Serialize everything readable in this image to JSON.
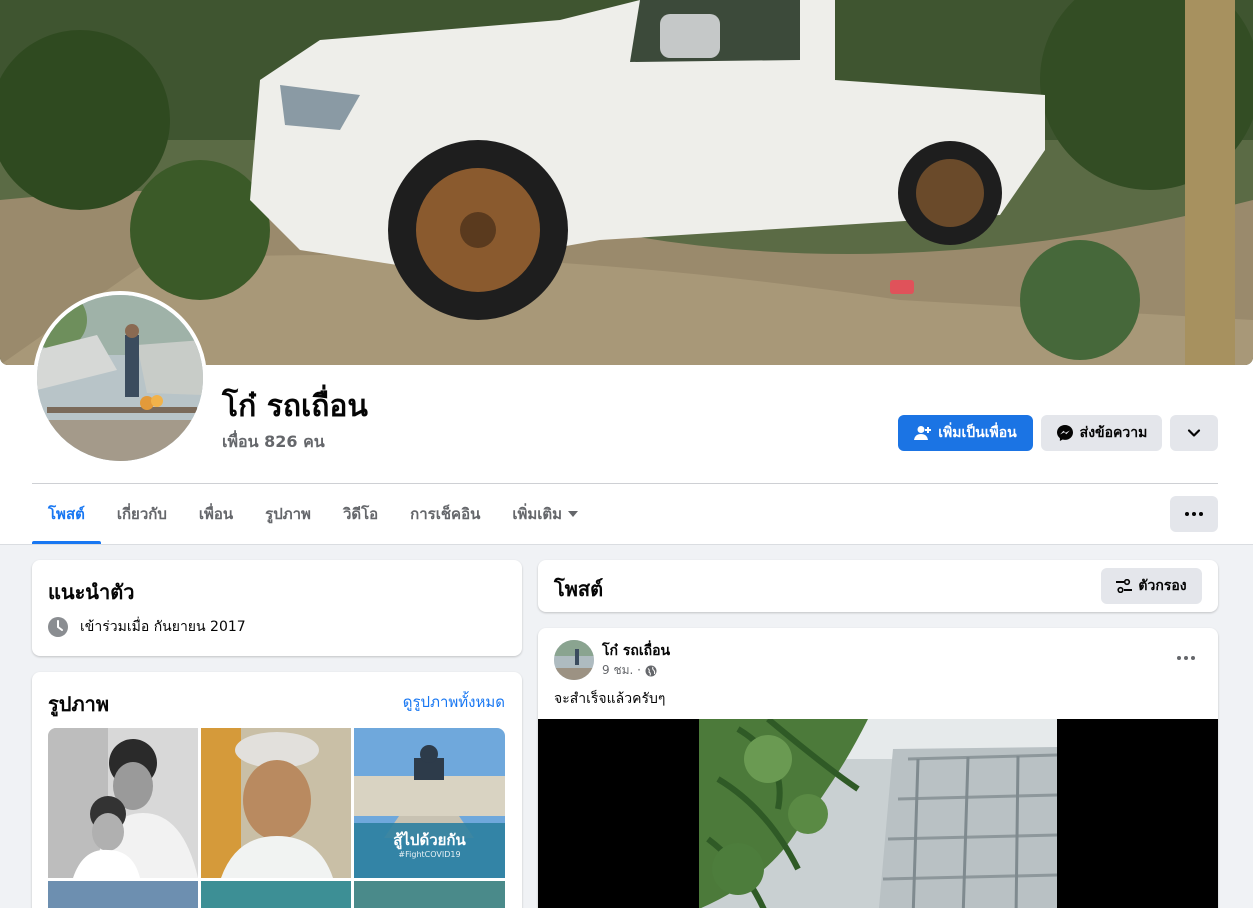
{
  "profile": {
    "name": "โก๋ รถเถื่อน",
    "friends_text": "เพื่อน 826 คน"
  },
  "actions": {
    "add_friend": "เพิ่มเป็นเพื่อน",
    "message": "ส่งข้อความ"
  },
  "tabs": [
    {
      "label": "โพสต์",
      "active": true
    },
    {
      "label": "เกี่ยวกับ"
    },
    {
      "label": "เพื่อน"
    },
    {
      "label": "รูปภาพ"
    },
    {
      "label": "วิดีโอ"
    },
    {
      "label": "การเช็คอิน"
    },
    {
      "label": "เพิ่มเติม"
    }
  ],
  "intro": {
    "title": "แนะนำตัว",
    "joined": "เข้าร่วมเมื่อ กันยายน 2017"
  },
  "photos": {
    "title": "รูปภาพ",
    "see_all": "ดูรูปภาพทั้งหมด",
    "covid_text": "สู้ไปด้วยกัน",
    "covid_tag": "#FightCOVID19"
  },
  "posts_header": {
    "title": "โพสต์",
    "filter": "ตัวกรอง"
  },
  "post": {
    "author": "โก๋ รถเถื่อน",
    "time": "9 ชม. ·",
    "text": "จะสำเร็จแล้วครับๆ"
  },
  "colors": {
    "primary": "#1b74e4",
    "link": "#1877f2",
    "background": "#f0f2f5",
    "secondary_button": "#e4e6eb"
  }
}
